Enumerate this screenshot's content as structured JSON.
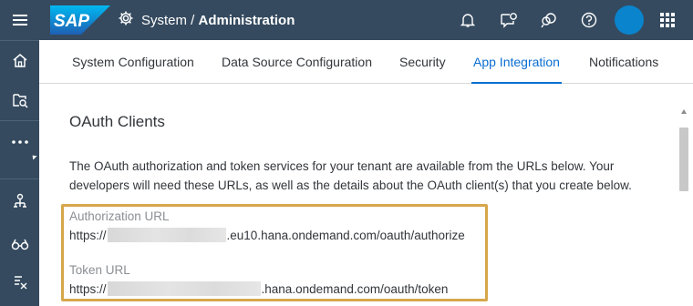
{
  "shell": {
    "logo_text": "SAP",
    "title_prefix": "System / ",
    "title_bold": "Administration",
    "icons": [
      "gear-icon",
      "bell-icon",
      "feedback-icon",
      "collaboration-icon",
      "help-icon",
      "avatar",
      "app-grid-icon"
    ]
  },
  "rail": {
    "items": [
      "menu-icon",
      "home-icon",
      "search-stories-icon",
      "more-icon",
      "connections-icon",
      "glasses-icon",
      "data-action-icon"
    ]
  },
  "tabs": [
    {
      "label": "System Configuration"
    },
    {
      "label": "Data Source Configuration"
    },
    {
      "label": "Security"
    },
    {
      "label": "App Integration"
    },
    {
      "label": "Notifications"
    }
  ],
  "active_tab": "App Integration",
  "main": {
    "section_title": "OAuth Clients",
    "description_line1": "The OAuth authorization and token services for your tenant are available from the URLs below. Your",
    "description_line2": "developers will need these URLs, as well as the details about the OAuth client(s) that you create below.",
    "auth_label": "Authorization URL",
    "auth_url_prefix": "https://",
    "auth_url_suffix": ".eu10.hana.ondemand.com/oauth/authorize",
    "token_label": "Token URL",
    "token_url_prefix": "https://",
    "token_url_suffix": ".hana.ondemand.com/oauth/token"
  },
  "colors": {
    "shell": "#354a5f",
    "accent": "#0a6ed1",
    "avatar": "#0a84cc",
    "highlight": "#d6a74a"
  }
}
